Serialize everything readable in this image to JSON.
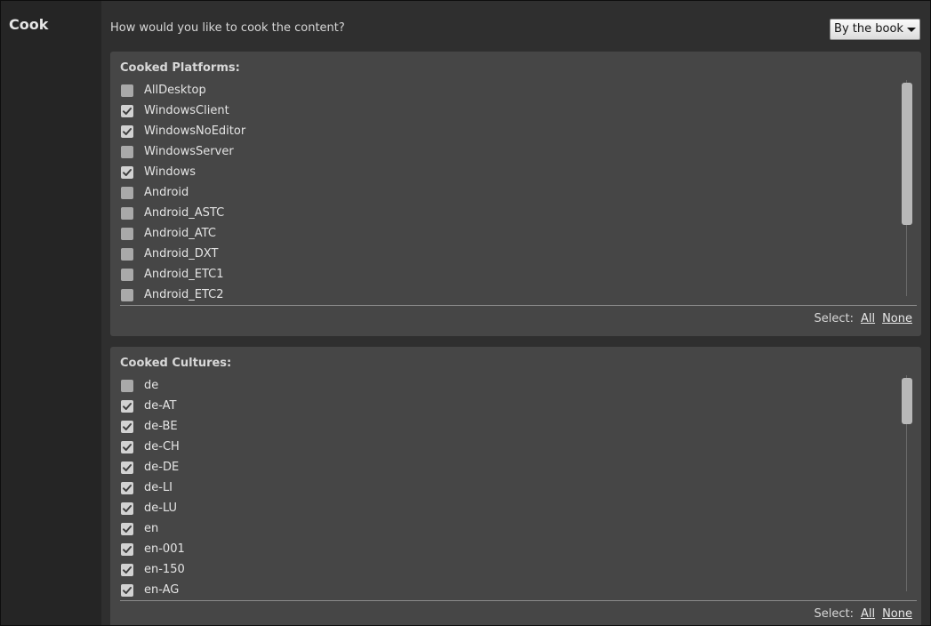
{
  "section": {
    "title": "Cook"
  },
  "header": {
    "question": "How would you like to cook the content?",
    "mode_dropdown": {
      "selected": "By the book"
    }
  },
  "platforms_panel": {
    "heading": "Cooked Platforms:",
    "items": [
      {
        "label": "AllDesktop",
        "checked": false
      },
      {
        "label": "WindowsClient",
        "checked": true
      },
      {
        "label": "WindowsNoEditor",
        "checked": true
      },
      {
        "label": "WindowsServer",
        "checked": false
      },
      {
        "label": "Windows",
        "checked": true
      },
      {
        "label": "Android",
        "checked": false
      },
      {
        "label": "Android_ASTC",
        "checked": false
      },
      {
        "label": "Android_ATC",
        "checked": false
      },
      {
        "label": "Android_DXT",
        "checked": false
      },
      {
        "label": "Android_ETC1",
        "checked": false
      },
      {
        "label": "Android_ETC2",
        "checked": false
      }
    ],
    "select_label": "Select:",
    "select_all": "All",
    "select_none": "None"
  },
  "cultures_panel": {
    "heading": "Cooked Cultures:",
    "items": [
      {
        "label": "de",
        "checked": false
      },
      {
        "label": "de-AT",
        "checked": true
      },
      {
        "label": "de-BE",
        "checked": true
      },
      {
        "label": "de-CH",
        "checked": true
      },
      {
        "label": "de-DE",
        "checked": true
      },
      {
        "label": "de-LI",
        "checked": true
      },
      {
        "label": "de-LU",
        "checked": true
      },
      {
        "label": "en",
        "checked": true
      },
      {
        "label": "en-001",
        "checked": true
      },
      {
        "label": "en-150",
        "checked": true
      },
      {
        "label": "en-AG",
        "checked": true
      }
    ],
    "select_label": "Select:",
    "select_all": "All",
    "select_none": "None"
  },
  "icons": {
    "checkbox_checked": "checkmark-icon",
    "dropdown": "caret-down-icon"
  },
  "colors": {
    "background": "#252525",
    "content_background": "#2f2f2f",
    "panel_background": "#464646",
    "checkbox_unchecked": "#a9a9a9",
    "checkbox_checked": "#d2d2d2",
    "text": "#e4e4e4"
  }
}
